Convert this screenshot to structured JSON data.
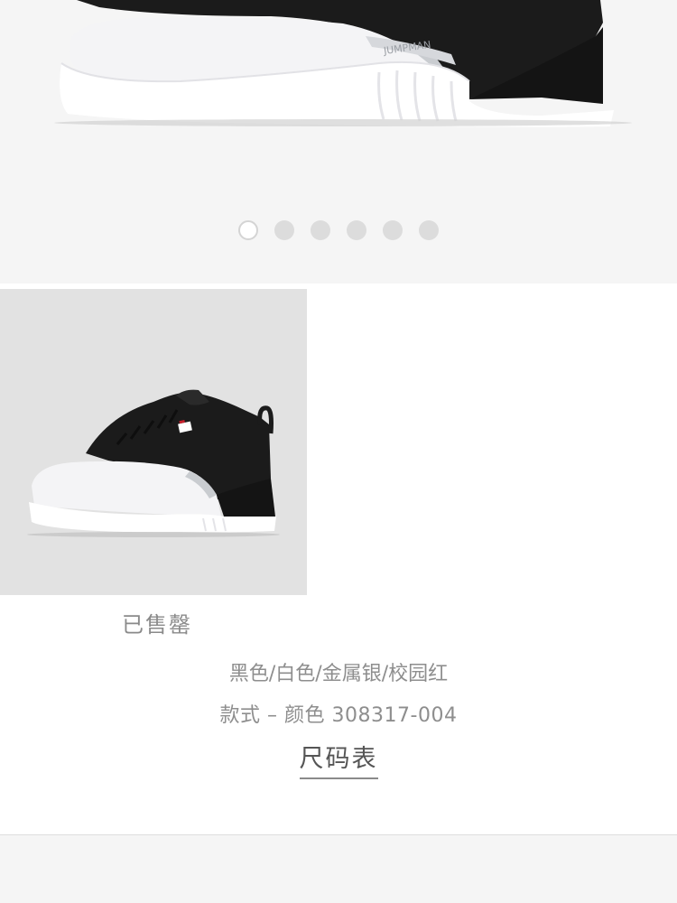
{
  "carousel": {
    "slide_count": 6,
    "active_index": 0
  },
  "product": {
    "status": "已售罄",
    "colorway": "黑色/白色/金属银/校园红",
    "style_code": "款式 – 颜色 308317-004",
    "size_chart_label": "尺码表",
    "heel_logo_text": "JUMPMAN"
  },
  "colors": {
    "hero_background": "#f5f5f5",
    "thumb_background": "#e2e2e2",
    "shoe_black": "#1b1b1b",
    "shoe_white": "#f4f4f6",
    "shoe_grey": "#c9ccd0",
    "accent_red": "#c8202c",
    "text_grey": "#8e8e8e"
  }
}
